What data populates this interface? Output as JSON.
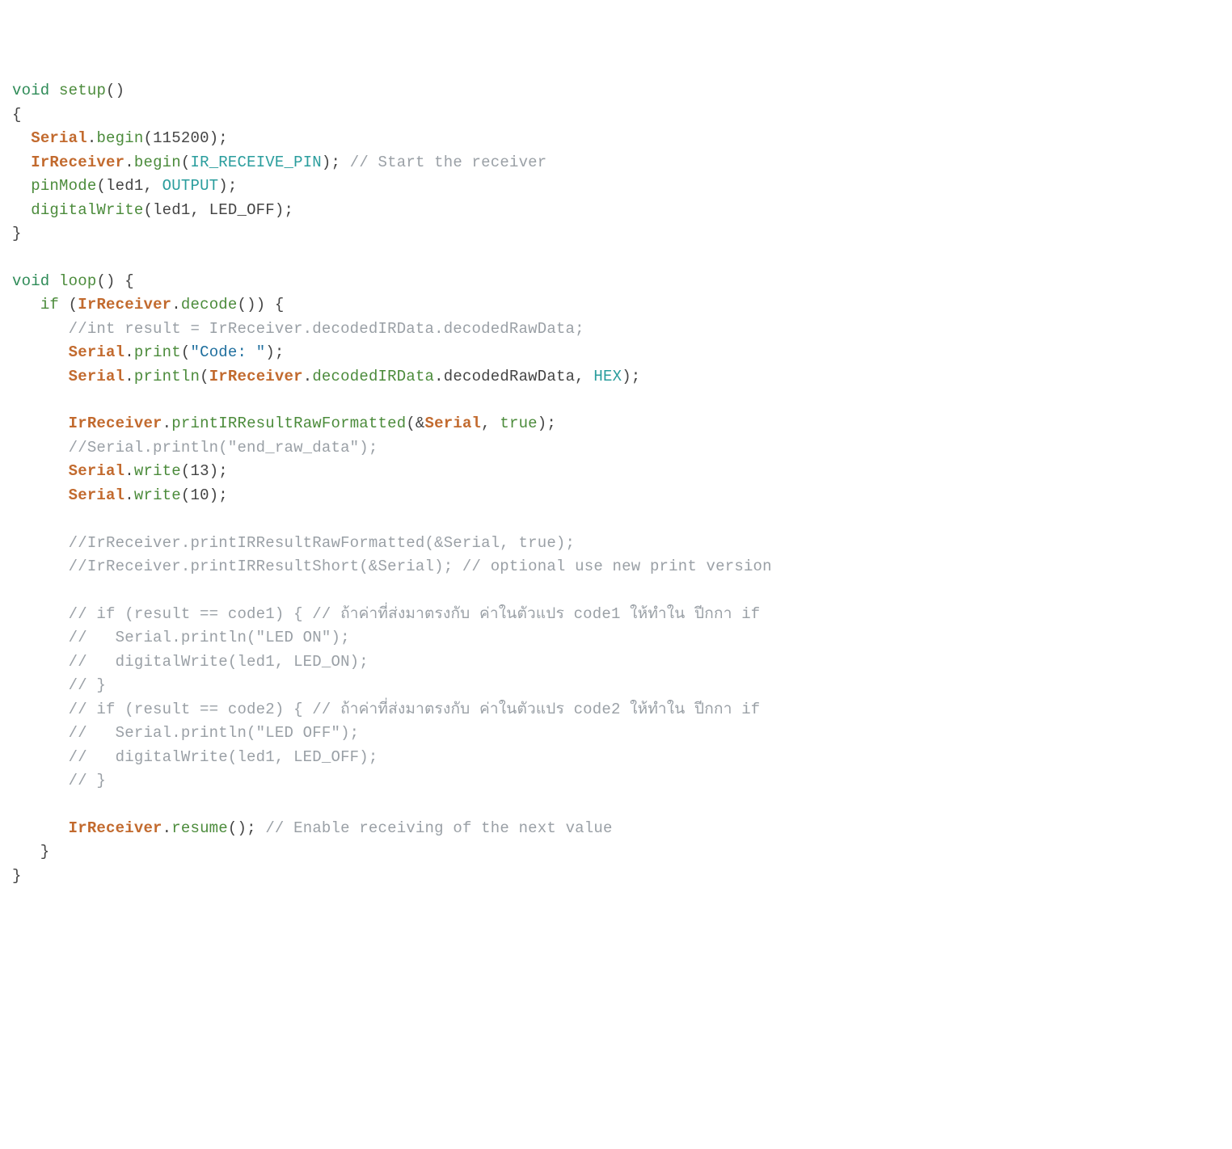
{
  "code": {
    "lines": [
      [
        {
          "cls": "kw-type",
          "t": "void"
        },
        {
          "cls": "punct",
          "t": " "
        },
        {
          "cls": "fn-name",
          "t": "setup"
        },
        {
          "cls": "punct",
          "t": "()"
        }
      ],
      [
        {
          "cls": "punct",
          "t": "{"
        }
      ],
      [
        {
          "cls": "punct",
          "t": "  "
        },
        {
          "cls": "id-cls",
          "t": "Serial"
        },
        {
          "cls": "punct",
          "t": "."
        },
        {
          "cls": "fn-name",
          "t": "begin"
        },
        {
          "cls": "punct",
          "t": "("
        },
        {
          "cls": "num",
          "t": "115200"
        },
        {
          "cls": "punct",
          "t": ");"
        }
      ],
      [
        {
          "cls": "punct",
          "t": "  "
        },
        {
          "cls": "id-cls",
          "t": "IrReceiver"
        },
        {
          "cls": "punct",
          "t": "."
        },
        {
          "cls": "fn-name",
          "t": "begin"
        },
        {
          "cls": "punct",
          "t": "("
        },
        {
          "cls": "const-id",
          "t": "IR_RECEIVE_PIN"
        },
        {
          "cls": "punct",
          "t": "); "
        },
        {
          "cls": "comment",
          "t": "// Start the receiver"
        }
      ],
      [
        {
          "cls": "punct",
          "t": "  "
        },
        {
          "cls": "fn-name",
          "t": "pinMode"
        },
        {
          "cls": "punct",
          "t": "(led1, "
        },
        {
          "cls": "const-id",
          "t": "OUTPUT"
        },
        {
          "cls": "punct",
          "t": ");"
        }
      ],
      [
        {
          "cls": "punct",
          "t": "  "
        },
        {
          "cls": "fn-name",
          "t": "digitalWrite"
        },
        {
          "cls": "punct",
          "t": "(led1, LED_OFF);"
        }
      ],
      [
        {
          "cls": "punct",
          "t": "}"
        }
      ],
      [
        {
          "cls": "punct",
          "t": ""
        }
      ],
      [
        {
          "cls": "kw-type",
          "t": "void"
        },
        {
          "cls": "punct",
          "t": " "
        },
        {
          "cls": "fn-name",
          "t": "loop"
        },
        {
          "cls": "punct",
          "t": "() {"
        }
      ],
      [
        {
          "cls": "punct",
          "t": "   "
        },
        {
          "cls": "kw-ctrl",
          "t": "if"
        },
        {
          "cls": "punct",
          "t": " ("
        },
        {
          "cls": "id-cls",
          "t": "IrReceiver"
        },
        {
          "cls": "punct",
          "t": "."
        },
        {
          "cls": "fn-name",
          "t": "decode"
        },
        {
          "cls": "punct",
          "t": "()) {"
        }
      ],
      [
        {
          "cls": "punct",
          "t": "      "
        },
        {
          "cls": "comment",
          "t": "//int result = IrReceiver.decodedIRData.decodedRawData;"
        }
      ],
      [
        {
          "cls": "punct",
          "t": "      "
        },
        {
          "cls": "id-cls",
          "t": "Serial"
        },
        {
          "cls": "punct",
          "t": "."
        },
        {
          "cls": "fn-name",
          "t": "print"
        },
        {
          "cls": "punct",
          "t": "("
        },
        {
          "cls": "str",
          "t": "\"Code: \""
        },
        {
          "cls": "punct",
          "t": ");"
        }
      ],
      [
        {
          "cls": "punct",
          "t": "      "
        },
        {
          "cls": "id-cls",
          "t": "Serial"
        },
        {
          "cls": "punct",
          "t": "."
        },
        {
          "cls": "fn-name",
          "t": "println"
        },
        {
          "cls": "punct",
          "t": "("
        },
        {
          "cls": "id-cls",
          "t": "IrReceiver"
        },
        {
          "cls": "punct",
          "t": "."
        },
        {
          "cls": "fn-name",
          "t": "decodedIRData"
        },
        {
          "cls": "punct",
          "t": ".decodedRawData, "
        },
        {
          "cls": "const-id",
          "t": "HEX"
        },
        {
          "cls": "punct",
          "t": ");"
        }
      ],
      [
        {
          "cls": "punct",
          "t": ""
        }
      ],
      [
        {
          "cls": "punct",
          "t": "      "
        },
        {
          "cls": "id-cls",
          "t": "IrReceiver"
        },
        {
          "cls": "punct",
          "t": "."
        },
        {
          "cls": "fn-name",
          "t": "printIRResultRawFormatted"
        },
        {
          "cls": "punct",
          "t": "(&"
        },
        {
          "cls": "id-cls",
          "t": "Serial"
        },
        {
          "cls": "punct",
          "t": ", "
        },
        {
          "cls": "kw-ctrl",
          "t": "true"
        },
        {
          "cls": "punct",
          "t": ");"
        }
      ],
      [
        {
          "cls": "punct",
          "t": "      "
        },
        {
          "cls": "comment",
          "t": "//Serial.println(\"end_raw_data\");"
        }
      ],
      [
        {
          "cls": "punct",
          "t": "      "
        },
        {
          "cls": "id-cls",
          "t": "Serial"
        },
        {
          "cls": "punct",
          "t": "."
        },
        {
          "cls": "fn-name",
          "t": "write"
        },
        {
          "cls": "punct",
          "t": "("
        },
        {
          "cls": "num",
          "t": "13"
        },
        {
          "cls": "punct",
          "t": ");"
        }
      ],
      [
        {
          "cls": "punct",
          "t": "      "
        },
        {
          "cls": "id-cls",
          "t": "Serial"
        },
        {
          "cls": "punct",
          "t": "."
        },
        {
          "cls": "fn-name",
          "t": "write"
        },
        {
          "cls": "punct",
          "t": "("
        },
        {
          "cls": "num",
          "t": "10"
        },
        {
          "cls": "punct",
          "t": ");"
        }
      ],
      [
        {
          "cls": "punct",
          "t": ""
        }
      ],
      [
        {
          "cls": "punct",
          "t": "      "
        },
        {
          "cls": "comment",
          "t": "//IrReceiver.printIRResultRawFormatted(&Serial, true);"
        }
      ],
      [
        {
          "cls": "punct",
          "t": "      "
        },
        {
          "cls": "comment",
          "t": "//IrReceiver.printIRResultShort(&Serial); // optional use new print version"
        }
      ],
      [
        {
          "cls": "punct",
          "t": ""
        }
      ],
      [
        {
          "cls": "punct",
          "t": "      "
        },
        {
          "cls": "comment",
          "t": "// if (result == code1) { // ถ้าค่าที่ส่งมาตรงกับ ค่าในตัวแปร code1 ให้ทำใน ปีกกา if"
        }
      ],
      [
        {
          "cls": "punct",
          "t": "      "
        },
        {
          "cls": "comment",
          "t": "//   Serial.println(\"LED ON\");"
        }
      ],
      [
        {
          "cls": "punct",
          "t": "      "
        },
        {
          "cls": "comment",
          "t": "//   digitalWrite(led1, LED_ON);"
        }
      ],
      [
        {
          "cls": "punct",
          "t": "      "
        },
        {
          "cls": "comment",
          "t": "// }"
        }
      ],
      [
        {
          "cls": "punct",
          "t": "      "
        },
        {
          "cls": "comment",
          "t": "// if (result == code2) { // ถ้าค่าที่ส่งมาตรงกับ ค่าในตัวแปร code2 ให้ทำใน ปีกกา if"
        }
      ],
      [
        {
          "cls": "punct",
          "t": "      "
        },
        {
          "cls": "comment",
          "t": "//   Serial.println(\"LED OFF\");"
        }
      ],
      [
        {
          "cls": "punct",
          "t": "      "
        },
        {
          "cls": "comment",
          "t": "//   digitalWrite(led1, LED_OFF);"
        }
      ],
      [
        {
          "cls": "punct",
          "t": "      "
        },
        {
          "cls": "comment",
          "t": "// }"
        }
      ],
      [
        {
          "cls": "punct",
          "t": ""
        }
      ],
      [
        {
          "cls": "punct",
          "t": "      "
        },
        {
          "cls": "id-cls",
          "t": "IrReceiver"
        },
        {
          "cls": "punct",
          "t": "."
        },
        {
          "cls": "fn-name",
          "t": "resume"
        },
        {
          "cls": "punct",
          "t": "(); "
        },
        {
          "cls": "comment",
          "t": "// Enable receiving of the next value"
        }
      ],
      [
        {
          "cls": "punct",
          "t": "   }"
        }
      ],
      [
        {
          "cls": "punct",
          "t": "}"
        }
      ]
    ]
  }
}
